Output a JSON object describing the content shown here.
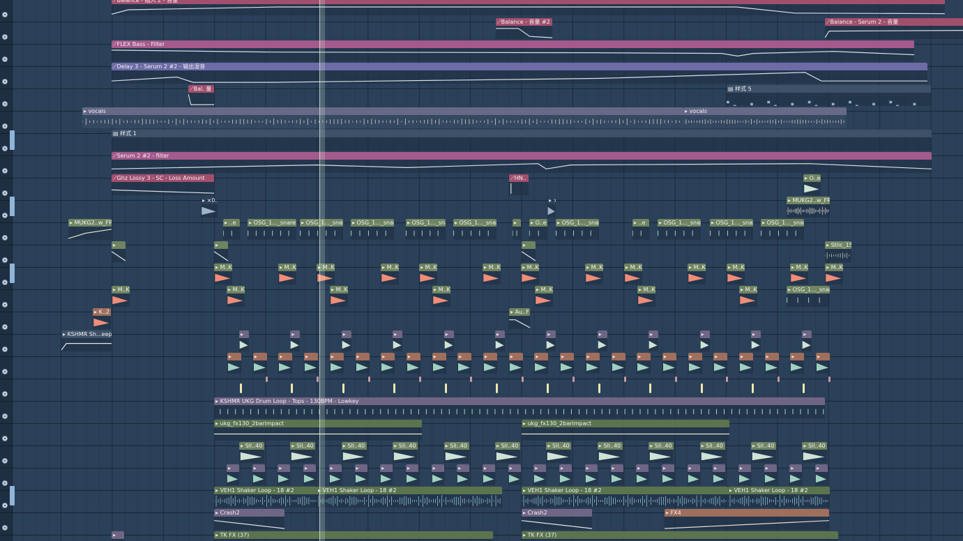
{
  "app": "FL Studio Playlist",
  "colors": {
    "background": "#2b4059",
    "auto_balance": "#a14f6d",
    "auto_filter": "#a45a8b",
    "auto_delay": "#6e6ba6",
    "audio_vocals": "#676a86",
    "pattern": "#3e5168",
    "drum_green": "#6f8460",
    "drum_orange": "#9f6e5c",
    "drum_purple": "#6f6584",
    "loop_green": "#5b744e",
    "playhead": "#e6f4ea"
  },
  "clips": {
    "balance_top": "Balance - 插入 2 - 音量",
    "balance_2": "Balance - 音量 #2",
    "balance_serum": "Balance - Serum 2 - 音量",
    "flex_bass": "FLEX Bass - Filter",
    "delay3": "Delay 3 - Serum 2 #2 - 输出湿音",
    "bal_short": "Bal. 量",
    "style5": "样式 5",
    "vocals_a": "vocals",
    "vocals_b": "vocals",
    "style1": "样式 1",
    "serum_filter": "Serum 2 #2 - filter",
    "ghz_lossy": "Ghz Lossy 3 - SC - Loss Amount",
    "hn": "HN..",
    "oe_small": "O..e",
    "x_mark_a": "×0..",
    "x_mark_b": "×",
    "mukg_right": "MUKG2..w_FRK",
    "mukg_left": "MUKG2..w_FRK",
    "e_a": "..e",
    "osg_snare": "OSG_1..._snare",
    "oe_mid": "O..e",
    "stlic": "Stlic_15",
    "mk": "M..K",
    "osg_right": "OSG_1..._snare",
    "k2": "K..2",
    "au": "Au..F",
    "kshmr_sweep": "KSHMR Sh...eep 05",
    "drum_loop": "KSHMR UKG Drum Loop - Tops - 130BPM - Lowkey",
    "impact_a": "ukg_fx130_2barimpact",
    "impact_b": "ukg_fx130_2barimpact",
    "sil40": "Sll..40",
    "shaker": "VEH1 Shaker Loop - 18 #2",
    "crash_a": "Crash2",
    "crash_b": "Crash2",
    "fx4": "FX4",
    "tk_fx_a": "TK FX (37)",
    "tk_fx_b": "TK FX (37)"
  }
}
